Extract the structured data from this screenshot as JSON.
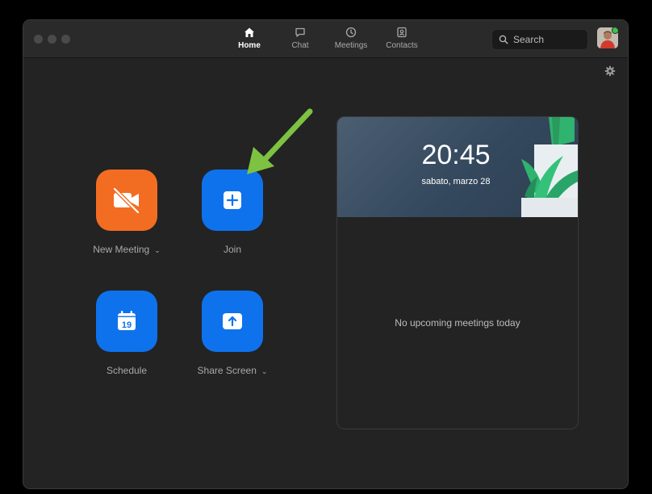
{
  "nav": {
    "tabs": [
      {
        "label": "Home",
        "icon": "home-icon",
        "active": true
      },
      {
        "label": "Chat",
        "icon": "chat-icon",
        "active": false
      },
      {
        "label": "Meetings",
        "icon": "clock-icon",
        "active": false
      },
      {
        "label": "Contacts",
        "icon": "contacts-icon",
        "active": false
      }
    ]
  },
  "search": {
    "placeholder": "Search"
  },
  "actions": {
    "new_meeting": "New Meeting",
    "join": "Join",
    "schedule": "Schedule",
    "schedule_day": "19",
    "share_screen": "Share Screen"
  },
  "calendar_card": {
    "time": "20:45",
    "date": "sabato, marzo 28",
    "empty_message": "No upcoming meetings today"
  },
  "colors": {
    "orange_tile": "#f26d21",
    "blue_tile": "#0e72ed",
    "annotation_arrow": "#7dc241",
    "presence": "#39c54a"
  }
}
